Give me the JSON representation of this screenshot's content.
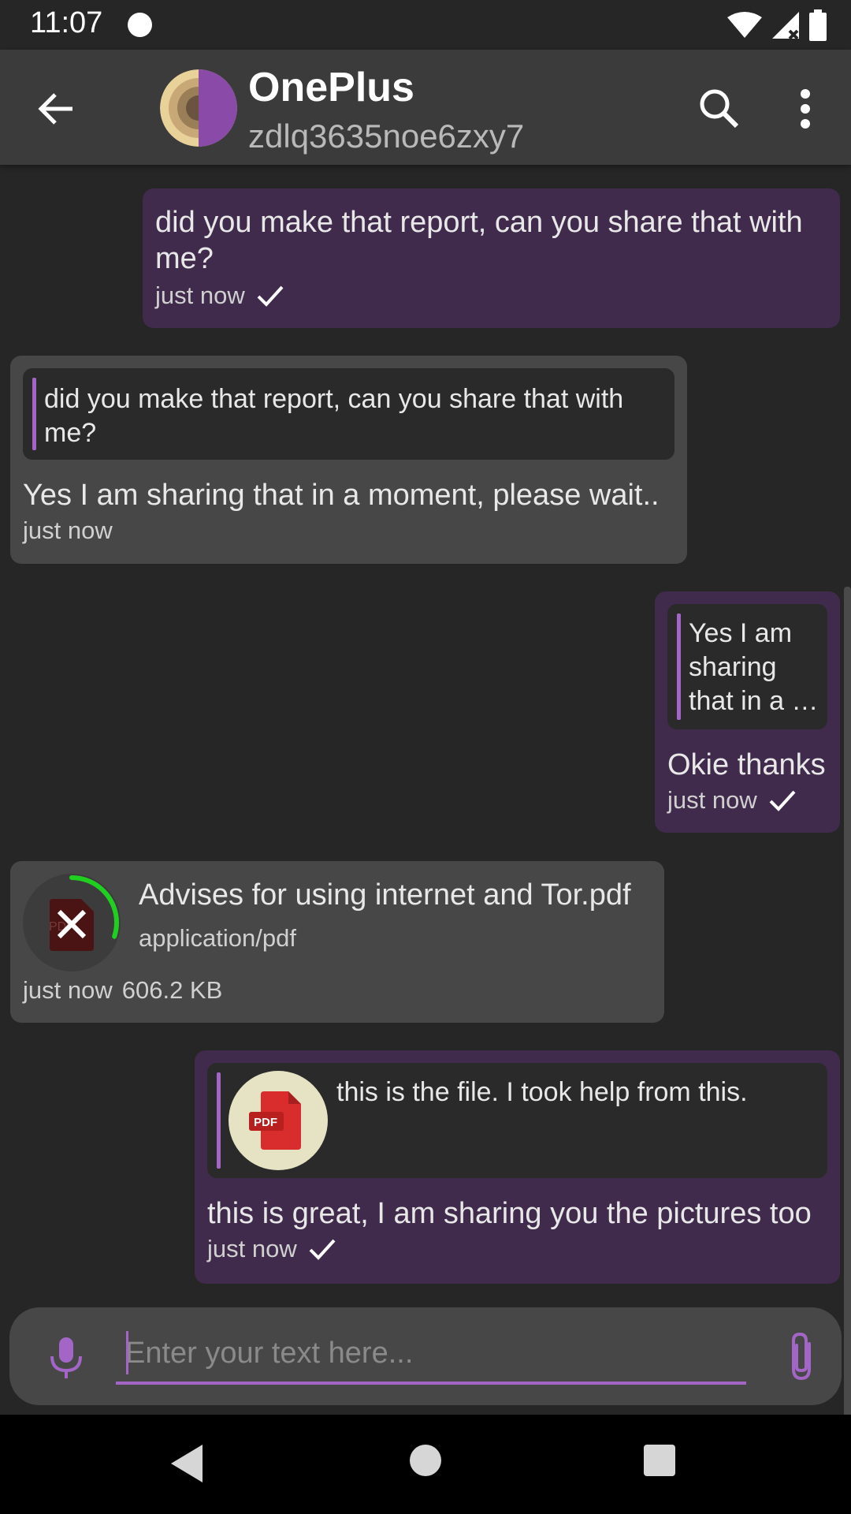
{
  "status": {
    "time": "11:07"
  },
  "header": {
    "name": "OnePlus",
    "subtitle": "zdlq3635noe6zxy7"
  },
  "messages": {
    "m1": {
      "text": "did you make that report, can you share that with me?",
      "time": "just now"
    },
    "m2": {
      "quote": "did you make that report, can you share that with me?",
      "text": "Yes I am sharing that in a moment, please wait..",
      "time": "just now"
    },
    "m3": {
      "quote": "Yes I am sharing that in a …",
      "text": "Okie thanks",
      "time": "just now"
    },
    "m4": {
      "file_name": "Advises for using internet and Tor.pdf",
      "mime": "application/pdf",
      "time": "just now",
      "size": "606.2 KB",
      "icon_label": "PDF",
      "download_progress": 0.3
    },
    "m5": {
      "quote": "this is the file. I took help from this.",
      "quote_icon_label": "PDF",
      "text": "this is great, I am sharing you the pictures too",
      "time": "just now"
    }
  },
  "input": {
    "placeholder": "Enter your text here..."
  },
  "colors": {
    "accent": "#a366c6",
    "outgoing_bubble": "#412b4d",
    "incoming_bubble": "#474747",
    "progress": "#20d020",
    "pdf_red": "#d92d2d"
  }
}
